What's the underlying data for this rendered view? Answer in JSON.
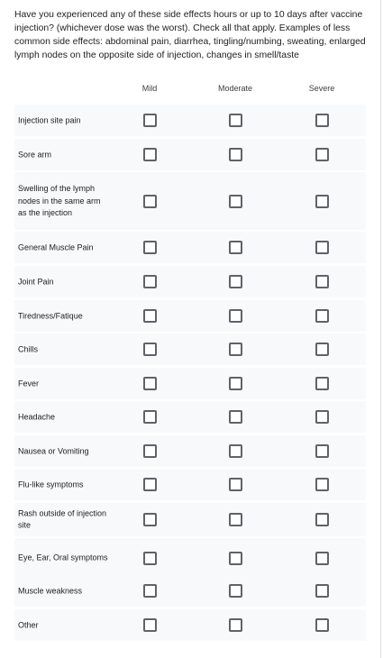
{
  "question": "Have you experienced any of these side effects hours or up to 10 days after vaccine injection? (whichever dose was the worst). Check all that apply. Examples of less common side effects: abdominal pain, diarrhea, tingling/numbing, sweating, enlarged lymph nodes on the opposite side of injection, changes in smell/taste",
  "columns": [
    "Mild",
    "Moderate",
    "Severe"
  ],
  "rows": [
    "Injection site pain",
    "Sore arm",
    "Swelling of the lymph nodes in the same arm as the injection",
    "General Muscle Pain",
    "Joint Pain",
    "Tiredness/Fatique",
    "Chills",
    "Fever",
    "Headache",
    "Nausea or Vomiting",
    "Flu-like symptoms",
    "Rash outside of injection site",
    "Eye, Ear, Oral symptoms",
    "Muscle weakness",
    "Other"
  ],
  "icons": {
    "checkbox": "checkbox-unchecked-icon"
  },
  "colors": {
    "row_background": "#f8f9fa",
    "checkbox_border": "#5f6368",
    "text": "#202124"
  }
}
